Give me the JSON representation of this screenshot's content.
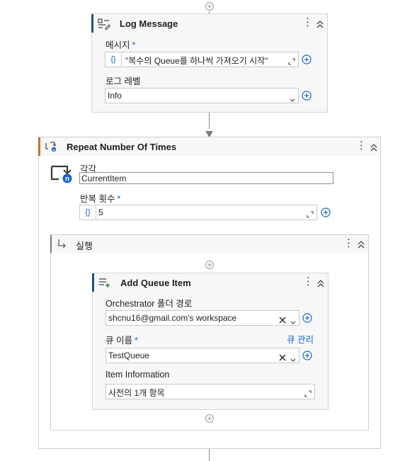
{
  "log_message": {
    "title": "Log Message",
    "message_label": "메시지",
    "message_value": "\"복수의 Queue를 하나씩 가져오기 시작\"",
    "level_label": "로그 레벨",
    "level_value": "Info"
  },
  "repeat": {
    "title": "Repeat Number Of Times",
    "each_label": "각각",
    "each_value": "CurrentItem",
    "count_label": "반복 횟수",
    "count_value": "5"
  },
  "body": {
    "title": "실행"
  },
  "add_queue_item": {
    "title": "Add Queue Item",
    "folder_label": "Orchestrator 폴더 경로",
    "folder_value": "shcnu16@gmail.com's workspace",
    "queue_name_label": "큐 이름",
    "manage_queues_link": "큐 관리",
    "queue_name_value": "TestQueue",
    "item_info_label": "Item Information",
    "item_info_value": "사전의 1개 항목"
  },
  "required_marker": "*",
  "variable_brace": "{}",
  "icons": {
    "badge_letter": "n"
  },
  "colors": {
    "accent_blue": "#1a63c6",
    "activity_bar": "#1f4e8c",
    "container_bar": "#c8702a",
    "card_background": "#f7f7f7"
  }
}
